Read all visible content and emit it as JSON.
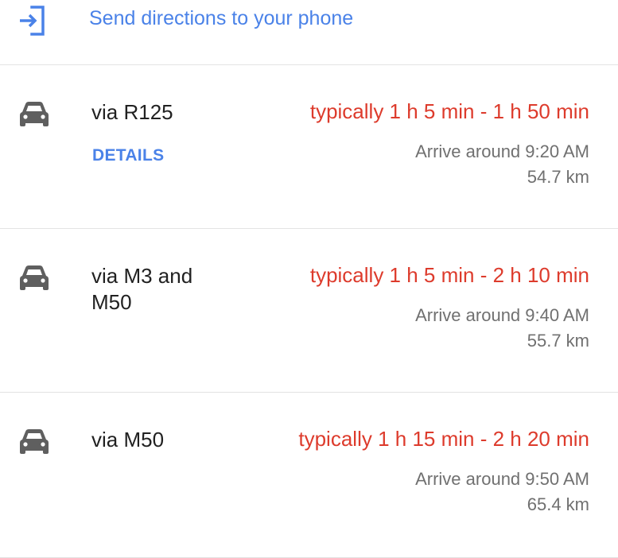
{
  "send_directions": {
    "label": "Send directions to your phone",
    "icon": "send-to-phone-icon",
    "color": "#4a82e8"
  },
  "routes": [
    {
      "name": "via R125",
      "duration": "typically 1 h 5 min - 1 h 50 min",
      "arrive": "Arrive around 9:20 AM",
      "distance": "54.7 km",
      "details_label": "DETAILS",
      "icon": "car-icon"
    },
    {
      "name": "via M3 and M50",
      "duration": "typically 1 h 5 min - 2 h 10 min",
      "arrive": "Arrive around 9:40 AM",
      "distance": "55.7 km",
      "icon": "car-icon"
    },
    {
      "name": "via M50",
      "duration": "typically 1 h 15 min - 2 h 20 min",
      "arrive": "Arrive around 9:50 AM",
      "distance": "65.4 km",
      "icon": "car-icon"
    }
  ],
  "colors": {
    "link": "#4a82e8",
    "duration": "#dd3b2c",
    "secondary_text": "#707070",
    "icon": "#5f5f5f"
  }
}
